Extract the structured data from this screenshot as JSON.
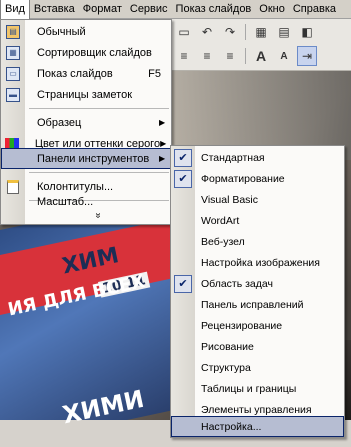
{
  "menubar": {
    "items": [
      "Вид",
      "Вставка",
      "Формат",
      "Сервис",
      "Показ слайдов",
      "Окно",
      "Справка"
    ]
  },
  "view_menu": {
    "items": [
      {
        "label": "Обычный",
        "icon": "normal-view-icon",
        "shortcut": ""
      },
      {
        "label": "Сортировщик слайдов",
        "icon": "slide-sorter-icon",
        "shortcut": ""
      },
      {
        "label": "Показ слайдов",
        "icon": "slide-show-icon",
        "shortcut": "F5"
      },
      {
        "label": "Страницы заметок",
        "icon": "notes-page-icon",
        "shortcut": ""
      },
      {
        "label": "Образец",
        "icon": "",
        "shortcut": "",
        "submenu": true
      },
      {
        "label": "Цвет или оттенки серого",
        "icon": "color-icon",
        "shortcut": "",
        "submenu": true
      },
      {
        "label": "Панели инструментов",
        "icon": "",
        "shortcut": "",
        "submenu": true,
        "highlighted": true
      },
      {
        "label": "Колонтитулы...",
        "icon": "header-footer-icon",
        "shortcut": ""
      },
      {
        "label": "Масштаб...",
        "icon": "",
        "shortcut": ""
      }
    ],
    "expand": "»"
  },
  "toolbars_submenu": {
    "items": [
      {
        "label": "Стандартная",
        "checked": true
      },
      {
        "label": "Форматирование",
        "checked": true
      },
      {
        "label": "Visual Basic",
        "checked": false
      },
      {
        "label": "WordArt",
        "checked": false
      },
      {
        "label": "Веб-узел",
        "checked": false
      },
      {
        "label": "Настройка изображения",
        "checked": false
      },
      {
        "label": "Область задач",
        "checked": true
      },
      {
        "label": "Панель исправлений",
        "checked": false
      },
      {
        "label": "Рецензирование",
        "checked": false
      },
      {
        "label": "Рисование",
        "checked": false
      },
      {
        "label": "Структура",
        "checked": false
      },
      {
        "label": "Таблицы и границы",
        "checked": false
      },
      {
        "label": "Элементы управления",
        "checked": false
      },
      {
        "label": "Настройка...",
        "checked": false,
        "highlighted": true
      }
    ]
  },
  "background_text": {
    "t1": "ХИМ",
    "t2": "10 11",
    "t3": "ИЯ ДЛЯ ВСЕХ",
    "t4": "ХИМИ"
  },
  "colors": {
    "menu_highlight": "#b6bdd2",
    "menu_border": "#0a246a",
    "menubar": "#d4d0c8"
  }
}
